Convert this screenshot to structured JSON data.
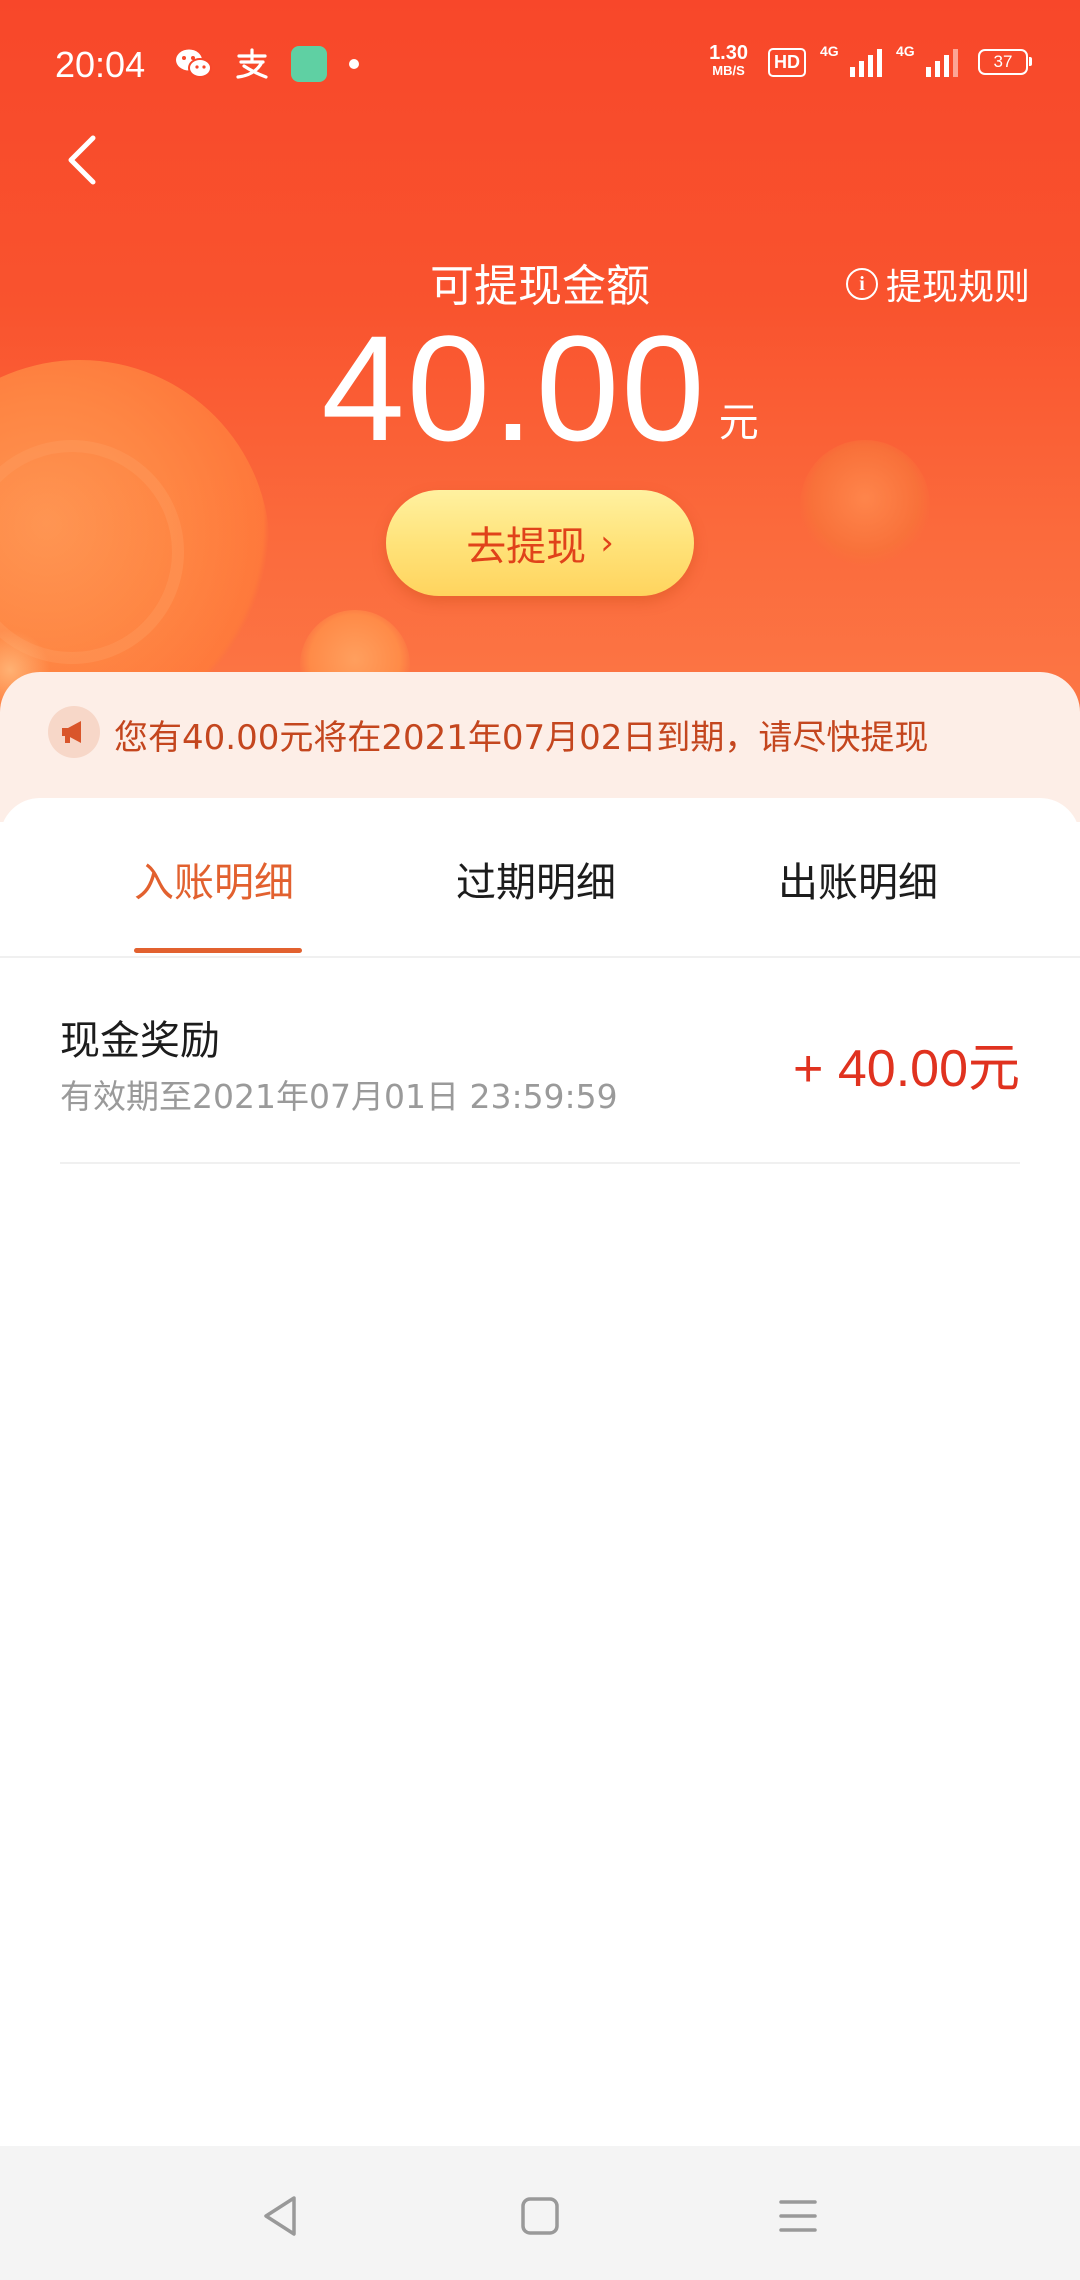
{
  "status_bar": {
    "time": "20:04",
    "speed_value": "1.30",
    "speed_unit": "MB/S",
    "hd_label": "HD",
    "network1": "4G",
    "network2": "4G",
    "battery": "37"
  },
  "header": {
    "title": "可提现金额",
    "rules_label": "提现规则",
    "amount": "40.00",
    "unit": "元",
    "withdraw_button": "去提现",
    "withdraw_chevron": "›"
  },
  "notice": {
    "text": "您有40.00元将在2021年07月02日到期，请尽快提现"
  },
  "tabs": [
    {
      "label": "入账明细",
      "active": true
    },
    {
      "label": "过期明细",
      "active": false
    },
    {
      "label": "出账明细",
      "active": false
    }
  ],
  "records": [
    {
      "title": "现金奖励",
      "subtitle": "有效期至2021年07月01日 23:59:59",
      "amount": "+ 40.00元"
    }
  ],
  "colors": {
    "header_red": "#f8472a",
    "accent_orange": "#e2612f",
    "amount_red": "#e0321f",
    "button_yellow": "#ffe37a",
    "notice_bg": "#fdeee7"
  },
  "icons": {
    "back": "chevron-left-icon",
    "rules": "info-icon",
    "notice": "megaphone-icon",
    "nav_back": "triangle-back-icon",
    "nav_home": "square-home-icon",
    "nav_menu": "menu-icon"
  }
}
